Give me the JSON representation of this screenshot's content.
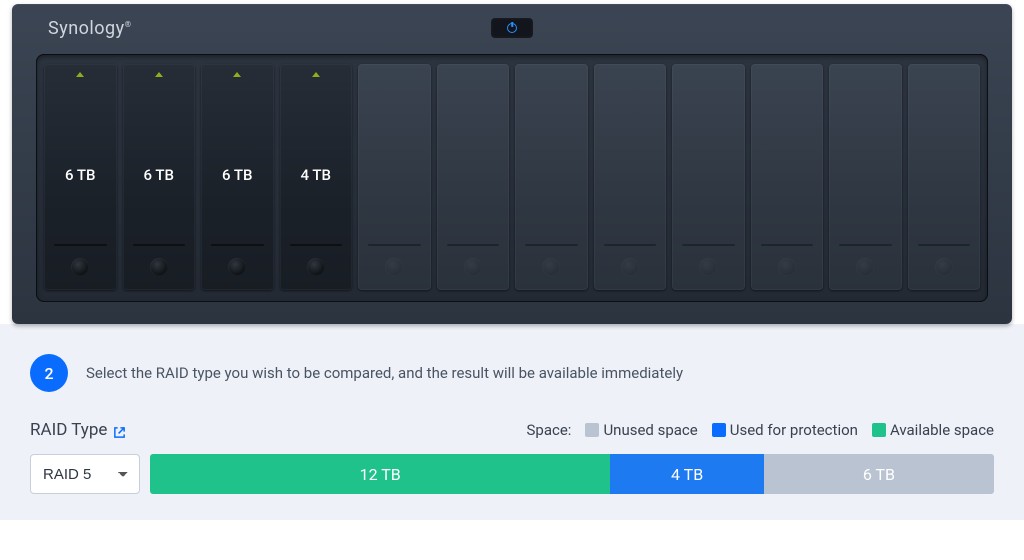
{
  "brand": "Synology",
  "bays": [
    {
      "filled": true,
      "capacity": "6 TB"
    },
    {
      "filled": true,
      "capacity": "6 TB"
    },
    {
      "filled": true,
      "capacity": "6 TB"
    },
    {
      "filled": true,
      "capacity": "4 TB"
    },
    {
      "filled": false,
      "capacity": ""
    },
    {
      "filled": false,
      "capacity": ""
    },
    {
      "filled": false,
      "capacity": ""
    },
    {
      "filled": false,
      "capacity": ""
    },
    {
      "filled": false,
      "capacity": ""
    },
    {
      "filled": false,
      "capacity": ""
    },
    {
      "filled": false,
      "capacity": ""
    },
    {
      "filled": false,
      "capacity": ""
    }
  ],
  "step": {
    "number": "2",
    "text": "Select the RAID type you wish to be compared, and the result will be available immediately"
  },
  "raid": {
    "label": "RAID Type",
    "selected": "RAID 5"
  },
  "legend": {
    "title": "Space:",
    "unused": "Unused space",
    "protection": "Used for protection",
    "available": "Available space"
  },
  "space": {
    "available_label": "12 TB",
    "protection_label": "4 TB",
    "unused_label": "6 TB",
    "available_tb": 12,
    "protection_tb": 4,
    "unused_tb": 6
  }
}
